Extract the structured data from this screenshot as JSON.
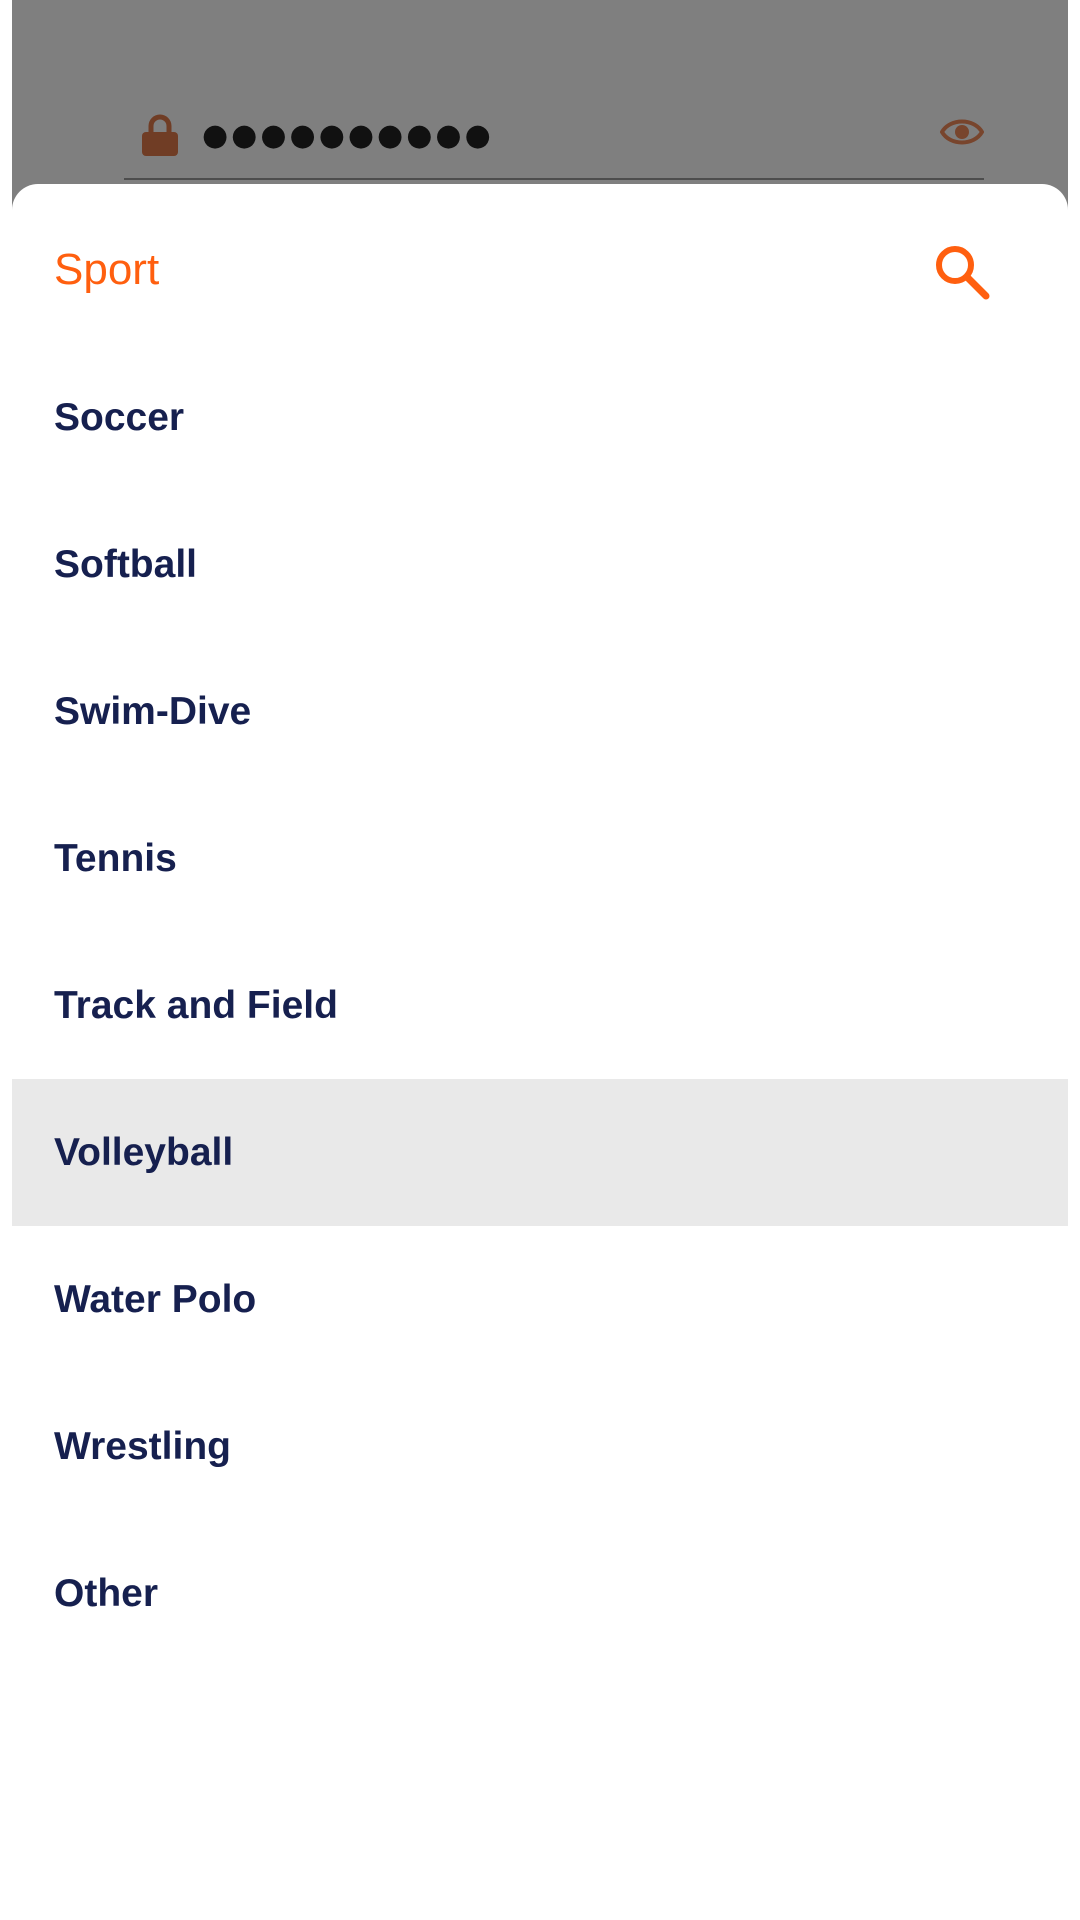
{
  "background_form": {
    "password_mask": "●●●●●●●●●●",
    "lock_icon": "lock-icon",
    "visibility_icon": "eye-icon"
  },
  "sheet": {
    "title": "Sport",
    "search_icon": "search-icon",
    "options": [
      {
        "label": "Soccer",
        "selected": false
      },
      {
        "label": "Softball",
        "selected": false
      },
      {
        "label": "Swim-Dive",
        "selected": false
      },
      {
        "label": "Tennis",
        "selected": false
      },
      {
        "label": "Track and Field",
        "selected": false
      },
      {
        "label": "Volleyball",
        "selected": true
      },
      {
        "label": "Water Polo",
        "selected": false
      },
      {
        "label": "Wrestling",
        "selected": false
      },
      {
        "label": "Other",
        "selected": false
      }
    ]
  },
  "colors": {
    "accent": "#ff5f0f",
    "option_text": "#16204f",
    "selected_row": "#e9e9e9",
    "scrim": "rgba(0,0,0,0.5)"
  }
}
